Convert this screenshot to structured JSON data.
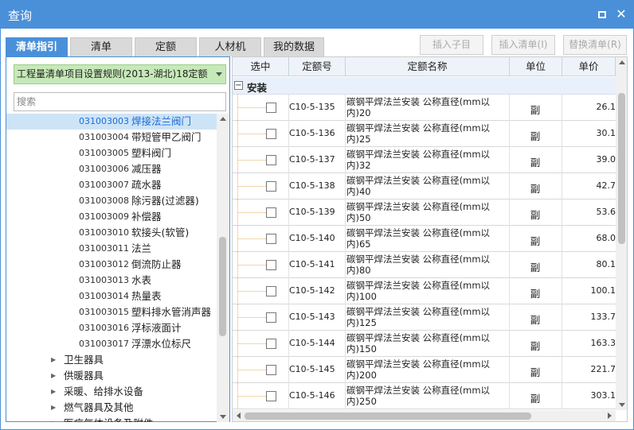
{
  "window": {
    "title": "查询"
  },
  "tabs": [
    {
      "label": "清单指引",
      "active": true
    },
    {
      "label": "清单",
      "active": false
    },
    {
      "label": "定额",
      "active": false
    },
    {
      "label": "人材机",
      "active": false
    },
    {
      "label": "我的数据",
      "active": false
    }
  ],
  "actions": {
    "insert_child": "插入子目",
    "insert_list": "插入清单(I)",
    "replace_list": "替换清单(R)"
  },
  "left": {
    "rule_select": "工程量清单项目设置规则(2013-湖北)18定额",
    "search_placeholder": "搜索",
    "tree_items": [
      {
        "code": "031003003",
        "name": "焊接法兰阀门",
        "selected": true
      },
      {
        "code": "031003004",
        "name": "带短管甲乙阀门"
      },
      {
        "code": "031003005",
        "name": "塑料阀门"
      },
      {
        "code": "031003006",
        "name": "减压器"
      },
      {
        "code": "031003007",
        "name": "疏水器"
      },
      {
        "code": "031003008",
        "name": "除污器(过滤器)"
      },
      {
        "code": "031003009",
        "name": "补偿器"
      },
      {
        "code": "031003010",
        "name": "软接头(软管)"
      },
      {
        "code": "031003011",
        "name": "法兰"
      },
      {
        "code": "031003012",
        "name": "倒流防止器"
      },
      {
        "code": "031003013",
        "name": "水表"
      },
      {
        "code": "031003014",
        "name": "热量表"
      },
      {
        "code": "031003015",
        "name": "塑料排水管消声器"
      },
      {
        "code": "031003016",
        "name": "浮标液面计"
      },
      {
        "code": "031003017",
        "name": "浮漂水位标尺"
      }
    ],
    "tree_groups": [
      {
        "label": "卫生器具",
        "icon": "expand-arrow-icon"
      },
      {
        "label": "供暖器具",
        "icon": "expand-arrow-icon"
      },
      {
        "label": "采暖、给排水设备",
        "icon": "expand-arrow-icon"
      },
      {
        "label": "燃气器具及其他",
        "icon": "expand-arrow-icon"
      },
      {
        "label": "医疗气体设备及附件",
        "icon": "expand-arrow-icon"
      }
    ]
  },
  "grid": {
    "headers": {
      "check": "选中",
      "code": "定额号",
      "name": "定额名称",
      "unit": "单位",
      "price": "单价"
    },
    "group": {
      "label": "安装",
      "toggle": "−"
    },
    "rows": [
      {
        "code": "C10-5-135",
        "name": "碳钢平焊法兰安装 公称直径(mm以内)20",
        "unit": "副",
        "price": "26.1"
      },
      {
        "code": "C10-5-136",
        "name": "碳钢平焊法兰安装 公称直径(mm以内)25",
        "unit": "副",
        "price": "30.1"
      },
      {
        "code": "C10-5-137",
        "name": "碳钢平焊法兰安装 公称直径(mm以内)32",
        "unit": "副",
        "price": "39.0"
      },
      {
        "code": "C10-5-138",
        "name": "碳钢平焊法兰安装 公称直径(mm以内)40",
        "unit": "副",
        "price": "42.7"
      },
      {
        "code": "C10-5-139",
        "name": "碳钢平焊法兰安装 公称直径(mm以内)50",
        "unit": "副",
        "price": "53.6"
      },
      {
        "code": "C10-5-140",
        "name": "碳钢平焊法兰安装 公称直径(mm以内)65",
        "unit": "副",
        "price": "68.0"
      },
      {
        "code": "C10-5-141",
        "name": "碳钢平焊法兰安装 公称直径(mm以内)80",
        "unit": "副",
        "price": "80.1"
      },
      {
        "code": "C10-5-142",
        "name": "碳钢平焊法兰安装 公称直径(mm以内)100",
        "unit": "副",
        "price": "100.1"
      },
      {
        "code": "C10-5-143",
        "name": "碳钢平焊法兰安装 公称直径(mm以内)125",
        "unit": "副",
        "price": "133.7"
      },
      {
        "code": "C10-5-144",
        "name": "碳钢平焊法兰安装 公称直径(mm以内)150",
        "unit": "副",
        "price": "163.3"
      },
      {
        "code": "C10-5-145",
        "name": "碳钢平焊法兰安装 公称直径(mm以内)200",
        "unit": "副",
        "price": "221.7"
      },
      {
        "code": "C10-5-146",
        "name": "碳钢平焊法兰安装 公称直径(mm以内)250",
        "unit": "副",
        "price": "303.1"
      }
    ]
  },
  "colors": {
    "accent": "#4a90d9",
    "selected_row": "#cde4f7",
    "rule_select_bg": "#c6e9b8"
  }
}
